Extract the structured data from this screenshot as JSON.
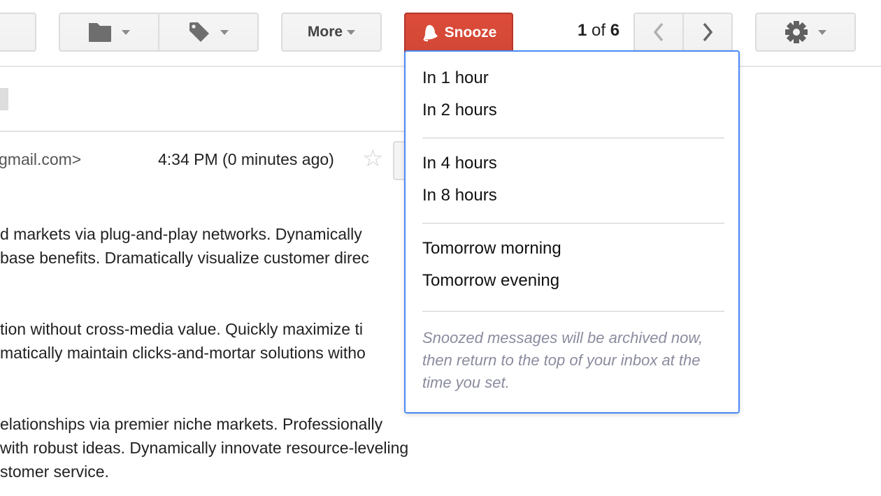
{
  "toolbar": {
    "more_label": "More",
    "snooze_label": "Snooze",
    "pager": {
      "current": "1",
      "of_label": "of",
      "total": "6"
    },
    "icons": {
      "move": "folder-icon",
      "labels": "tag-icon",
      "snooze": "bell-icon",
      "prev": "chevron-left-icon",
      "next": "chevron-right-icon",
      "settings": "gear-icon"
    }
  },
  "message": {
    "sender_email_fragment": "gmail.com>",
    "sender_prefix": "",
    "timestamp": "4:34 PM (0 minutes ago)",
    "body_lines": [
      "d markets via plug-and-play networks. Dynamically",
      "base benefits. Dramatically visualize customer direc",
      "tion without cross-media value. Quickly maximize ti",
      "matically maintain clicks-and-mortar solutions witho",
      "elationships via premier niche markets. Professionally",
      "with robust ideas. Dynamically innovate resource-leveling",
      "stomer service."
    ]
  },
  "snooze_menu": {
    "groups": [
      [
        "In 1 hour",
        "In 2 hours"
      ],
      [
        "In 4 hours",
        "In 8 hours"
      ],
      [
        "Tomorrow morning",
        "Tomorrow evening"
      ]
    ],
    "note": "Snoozed messages will be archived now, then return to the top of your inbox at the time you set."
  },
  "colors": {
    "snooze_red": "#d14836",
    "menu_border_blue": "#4a8af4",
    "note_gray": "#8a8c9e"
  }
}
